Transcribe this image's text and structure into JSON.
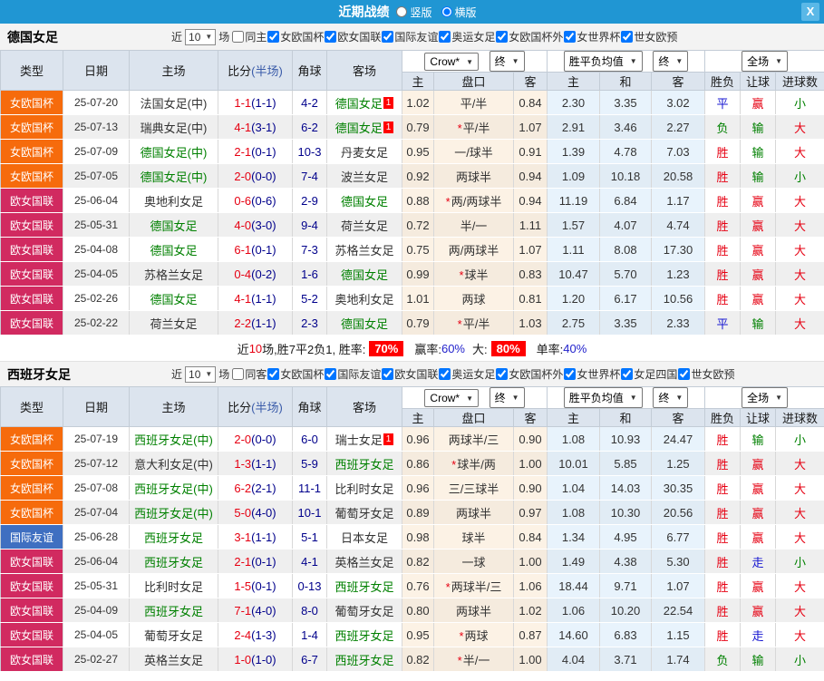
{
  "titlebar": {
    "title": "近期战绩",
    "radio_vertical": "竖版",
    "radio_horizontal": "横版",
    "close": "X"
  },
  "columns": {
    "type": "类型",
    "date": "日期",
    "home": "主场",
    "score": "比分",
    "score_half": "(半场)",
    "corner": "角球",
    "away": "客场",
    "a_home": "主",
    "a_line": "盘口",
    "a_away": "客",
    "e_home": "主",
    "e_draw": "和",
    "e_away": "客",
    "wl": "胜负",
    "hc": "让球",
    "goals": "进球数"
  },
  "dropdowns": {
    "asian_provider": "Crow*",
    "asian_state": "终",
    "euro_provider": "胜平负均值",
    "euro_state": "终",
    "scope": "全场",
    "arrow": "▼"
  },
  "type_colors": {
    "女欧国杯": "#f66b0c",
    "欧女国联": "#d12a60",
    "国际友谊": "#3f6fc1"
  },
  "result_colors": {
    "胜": "#e60012",
    "平": "#1717d1",
    "负": "#008000",
    "赢": "#e60012",
    "走": "#1717d1",
    "输": "#008000",
    "大": "#e60012",
    "小": "#008000"
  },
  "sections": [
    {
      "team": "德国女足",
      "filter": {
        "label_near": "近",
        "count": "10",
        "label_games": "场",
        "same": {
          "label": "同主",
          "checked": false
        },
        "leagues": [
          "女欧国杯",
          "欧女国联",
          "国际友谊",
          "奥运女足",
          "女欧国杯外",
          "女世界杯",
          "世女欧预"
        ]
      },
      "rows": [
        {
          "type": "女欧国杯",
          "date": "25-07-20",
          "home": "法国女足(中)",
          "home_green": false,
          "home_badge": null,
          "score": "1-1",
          "half": "(1-1)",
          "corner": "4-2",
          "away": "德国女足",
          "away_green": true,
          "away_badge": "1",
          "asian": [
            "1.02",
            "平/半",
            "0.84"
          ],
          "euro": [
            "2.30",
            "3.35",
            "3.02"
          ],
          "results": [
            "平",
            "赢",
            "小"
          ]
        },
        {
          "type": "女欧国杯",
          "date": "25-07-13",
          "home": "瑞典女足(中)",
          "home_green": false,
          "home_badge": null,
          "score": "4-1",
          "half": "(3-1)",
          "corner": "6-2",
          "away": "德国女足",
          "away_green": true,
          "away_badge": "1",
          "asian": [
            "0.79",
            "*平/半",
            "1.07"
          ],
          "euro": [
            "2.91",
            "3.46",
            "2.27"
          ],
          "results": [
            "负",
            "输",
            "大"
          ]
        },
        {
          "type": "女欧国杯",
          "date": "25-07-09",
          "home": "德国女足(中)",
          "home_green": true,
          "home_badge": null,
          "score": "2-1",
          "half": "(0-1)",
          "corner": "10-3",
          "away": "丹麦女足",
          "away_green": false,
          "away_badge": null,
          "asian": [
            "0.95",
            "一/球半",
            "0.91"
          ],
          "euro": [
            "1.39",
            "4.78",
            "7.03"
          ],
          "results": [
            "胜",
            "输",
            "大"
          ]
        },
        {
          "type": "女欧国杯",
          "date": "25-07-05",
          "home": "德国女足(中)",
          "home_green": true,
          "home_badge": null,
          "score": "2-0",
          "half": "(0-0)",
          "corner": "7-4",
          "away": "波兰女足",
          "away_green": false,
          "away_badge": null,
          "asian": [
            "0.92",
            "两球半",
            "0.94"
          ],
          "euro": [
            "1.09",
            "10.18",
            "20.58"
          ],
          "results": [
            "胜",
            "输",
            "小"
          ]
        },
        {
          "type": "欧女国联",
          "date": "25-06-04",
          "home": "奥地利女足",
          "home_green": false,
          "home_badge": null,
          "score": "0-6",
          "half": "(0-6)",
          "corner": "2-9",
          "away": "德国女足",
          "away_green": true,
          "away_badge": null,
          "asian": [
            "0.88",
            "*两/两球半",
            "0.94"
          ],
          "euro": [
            "11.19",
            "6.84",
            "1.17"
          ],
          "results": [
            "胜",
            "赢",
            "大"
          ]
        },
        {
          "type": "欧女国联",
          "date": "25-05-31",
          "home": "德国女足",
          "home_green": true,
          "home_badge": null,
          "score": "4-0",
          "half": "(3-0)",
          "corner": "9-4",
          "away": "荷兰女足",
          "away_green": false,
          "away_badge": null,
          "asian": [
            "0.72",
            "半/一",
            "1.11"
          ],
          "euro": [
            "1.57",
            "4.07",
            "4.74"
          ],
          "results": [
            "胜",
            "赢",
            "大"
          ]
        },
        {
          "type": "欧女国联",
          "date": "25-04-08",
          "home": "德国女足",
          "home_green": true,
          "home_badge": null,
          "score": "6-1",
          "half": "(0-1)",
          "corner": "7-3",
          "away": "苏格兰女足",
          "away_green": false,
          "away_badge": null,
          "asian": [
            "0.75",
            "两/两球半",
            "1.07"
          ],
          "euro": [
            "1.11",
            "8.08",
            "17.30"
          ],
          "results": [
            "胜",
            "赢",
            "大"
          ]
        },
        {
          "type": "欧女国联",
          "date": "25-04-05",
          "home": "苏格兰女足",
          "home_green": false,
          "home_badge": null,
          "score": "0-4",
          "half": "(0-2)",
          "corner": "1-6",
          "away": "德国女足",
          "away_green": true,
          "away_badge": null,
          "asian": [
            "0.99",
            "*球半",
            "0.83"
          ],
          "euro": [
            "10.47",
            "5.70",
            "1.23"
          ],
          "results": [
            "胜",
            "赢",
            "大"
          ]
        },
        {
          "type": "欧女国联",
          "date": "25-02-26",
          "home": "德国女足",
          "home_green": true,
          "home_badge": null,
          "score": "4-1",
          "half": "(1-1)",
          "corner": "5-2",
          "away": "奥地利女足",
          "away_green": false,
          "away_badge": null,
          "asian": [
            "1.01",
            "两球",
            "0.81"
          ],
          "euro": [
            "1.20",
            "6.17",
            "10.56"
          ],
          "results": [
            "胜",
            "赢",
            "大"
          ]
        },
        {
          "type": "欧女国联",
          "date": "25-02-22",
          "home": "荷兰女足",
          "home_green": false,
          "home_badge": null,
          "score": "2-2",
          "half": "(1-1)",
          "corner": "2-3",
          "away": "德国女足",
          "away_green": true,
          "away_badge": null,
          "asian": [
            "0.79",
            "*平/半",
            "1.03"
          ],
          "euro": [
            "2.75",
            "3.35",
            "2.33"
          ],
          "results": [
            "平",
            "输",
            "大"
          ]
        }
      ],
      "summary": {
        "t1": "近",
        "t2": "10",
        "t3": "场,胜7平2负1, 胜率:",
        "win": "70%",
        "t4": "赢率:",
        "win2": "60%",
        "t5": "大:",
        "big": "80%",
        "t6": "单率:",
        "single": "40%"
      }
    },
    {
      "team": "西班牙女足",
      "filter": {
        "label_near": "近",
        "count": "10",
        "label_games": "场",
        "same": {
          "label": "同客",
          "checked": false
        },
        "leagues": [
          "女欧国杯",
          "国际友谊",
          "欧女国联",
          "奥运女足",
          "女欧国杯外",
          "女世界杯",
          "女足四国",
          "世女欧预"
        ]
      },
      "rows": [
        {
          "type": "女欧国杯",
          "date": "25-07-19",
          "home": "西班牙女足(中)",
          "home_green": true,
          "home_badge": null,
          "score": "2-0",
          "half": "(0-0)",
          "corner": "6-0",
          "away": "瑞士女足",
          "away_green": false,
          "away_badge": "1",
          "asian": [
            "0.96",
            "两球半/三",
            "0.90"
          ],
          "euro": [
            "1.08",
            "10.93",
            "24.47"
          ],
          "results": [
            "胜",
            "输",
            "小"
          ]
        },
        {
          "type": "女欧国杯",
          "date": "25-07-12",
          "home": "意大利女足(中)",
          "home_green": false,
          "home_badge": null,
          "score": "1-3",
          "half": "(1-1)",
          "corner": "5-9",
          "away": "西班牙女足",
          "away_green": true,
          "away_badge": null,
          "asian": [
            "0.86",
            "*球半/两",
            "1.00"
          ],
          "euro": [
            "10.01",
            "5.85",
            "1.25"
          ],
          "results": [
            "胜",
            "赢",
            "大"
          ]
        },
        {
          "type": "女欧国杯",
          "date": "25-07-08",
          "home": "西班牙女足(中)",
          "home_green": true,
          "home_badge": null,
          "score": "6-2",
          "half": "(2-1)",
          "corner": "11-1",
          "away": "比利时女足",
          "away_green": false,
          "away_badge": null,
          "asian": [
            "0.96",
            "三/三球半",
            "0.90"
          ],
          "euro": [
            "1.04",
            "14.03",
            "30.35"
          ],
          "results": [
            "胜",
            "赢",
            "大"
          ]
        },
        {
          "type": "女欧国杯",
          "date": "25-07-04",
          "home": "西班牙女足(中)",
          "home_green": true,
          "home_badge": null,
          "score": "5-0",
          "half": "(4-0)",
          "corner": "10-1",
          "away": "葡萄牙女足",
          "away_green": false,
          "away_badge": null,
          "asian": [
            "0.89",
            "两球半",
            "0.97"
          ],
          "euro": [
            "1.08",
            "10.30",
            "20.56"
          ],
          "results": [
            "胜",
            "赢",
            "大"
          ]
        },
        {
          "type": "国际友谊",
          "date": "25-06-28",
          "home": "西班牙女足",
          "home_green": true,
          "home_badge": null,
          "score": "3-1",
          "half": "(1-1)",
          "corner": "5-1",
          "away": "日本女足",
          "away_green": false,
          "away_badge": null,
          "asian": [
            "0.98",
            "球半",
            "0.84"
          ],
          "euro": [
            "1.34",
            "4.95",
            "6.77"
          ],
          "results": [
            "胜",
            "赢",
            "大"
          ]
        },
        {
          "type": "欧女国联",
          "date": "25-06-04",
          "home": "西班牙女足",
          "home_green": true,
          "home_badge": null,
          "score": "2-1",
          "half": "(0-1)",
          "corner": "4-1",
          "away": "英格兰女足",
          "away_green": false,
          "away_badge": null,
          "asian": [
            "0.82",
            "一球",
            "1.00"
          ],
          "euro": [
            "1.49",
            "4.38",
            "5.30"
          ],
          "results": [
            "胜",
            "走",
            "小"
          ]
        },
        {
          "type": "欧女国联",
          "date": "25-05-31",
          "home": "比利时女足",
          "home_green": false,
          "home_badge": null,
          "score": "1-5",
          "half": "(0-1)",
          "corner": "0-13",
          "away": "西班牙女足",
          "away_green": true,
          "away_badge": null,
          "asian": [
            "0.76",
            "*两球半/三",
            "1.06"
          ],
          "euro": [
            "18.44",
            "9.71",
            "1.07"
          ],
          "results": [
            "胜",
            "赢",
            "大"
          ]
        },
        {
          "type": "欧女国联",
          "date": "25-04-09",
          "home": "西班牙女足",
          "home_green": true,
          "home_badge": null,
          "score": "7-1",
          "half": "(4-0)",
          "corner": "8-0",
          "away": "葡萄牙女足",
          "away_green": false,
          "away_badge": null,
          "asian": [
            "0.80",
            "两球半",
            "1.02"
          ],
          "euro": [
            "1.06",
            "10.20",
            "22.54"
          ],
          "results": [
            "胜",
            "赢",
            "大"
          ]
        },
        {
          "type": "欧女国联",
          "date": "25-04-05",
          "home": "葡萄牙女足",
          "home_green": false,
          "home_badge": null,
          "score": "2-4",
          "half": "(1-3)",
          "corner": "1-4",
          "away": "西班牙女足",
          "away_green": true,
          "away_badge": null,
          "asian": [
            "0.95",
            "*两球",
            "0.87"
          ],
          "euro": [
            "14.60",
            "6.83",
            "1.15"
          ],
          "results": [
            "胜",
            "走",
            "大"
          ]
        },
        {
          "type": "欧女国联",
          "date": "25-02-27",
          "home": "英格兰女足",
          "home_green": false,
          "home_badge": null,
          "score": "1-0",
          "half": "(1-0)",
          "corner": "6-7",
          "away": "西班牙女足",
          "away_green": true,
          "away_badge": null,
          "asian": [
            "0.82",
            "*半/一",
            "1.00"
          ],
          "euro": [
            "4.04",
            "3.71",
            "1.74"
          ],
          "results": [
            "负",
            "输",
            "小"
          ]
        }
      ],
      "summary": null
    }
  ]
}
